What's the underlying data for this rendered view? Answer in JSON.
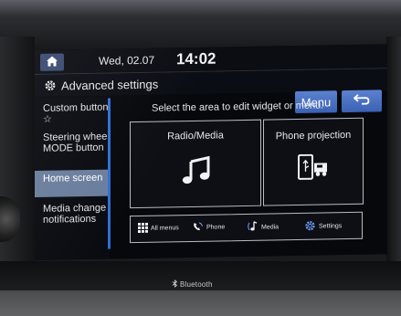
{
  "status_bar": {
    "date": "Wed, 02.07",
    "time": "14:02"
  },
  "header": {
    "title": "Advanced settings",
    "menu_label": "Menu"
  },
  "sidebar": {
    "items": [
      {
        "label": "Custom button ☆",
        "selected": false
      },
      {
        "label": "Steering wheel MODE button",
        "selected": false
      },
      {
        "label": "Home screen",
        "selected": true
      },
      {
        "label": "Media change notifications",
        "selected": false
      }
    ]
  },
  "main": {
    "instruction": "Select the area to edit widget or menu.",
    "widgets": [
      {
        "label": "Radio/Media",
        "icon": "music-note-icon"
      },
      {
        "label": "Phone projection",
        "icon": "phone-projection-icon"
      }
    ],
    "shortcuts": [
      {
        "label": "All menus",
        "icon": "grid-icon"
      },
      {
        "label": "Phone",
        "icon": "phone-icon"
      },
      {
        "label": "Media",
        "icon": "media-note-icon"
      },
      {
        "label": "Settings",
        "icon": "gear-icon"
      }
    ]
  },
  "hardware": {
    "bezel_label": "Bluetooth"
  },
  "colors": {
    "accent": "#4a72c4",
    "selected_item": "#6a7e9c",
    "scrollbar": "#2e6fd8"
  }
}
